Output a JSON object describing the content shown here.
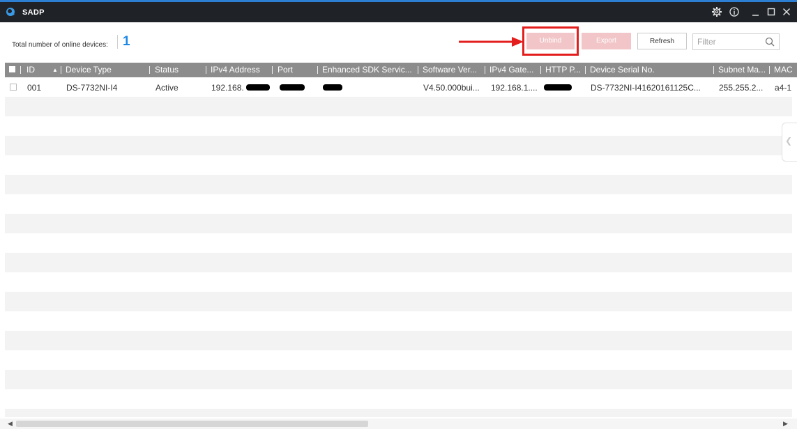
{
  "window": {
    "title": "SADP"
  },
  "toolbar": {
    "total_label": "Total number of online devices:",
    "total_count": "1",
    "unbind_label": "Unbind",
    "export_label": "Export",
    "refresh_label": "Refresh",
    "filter_placeholder": "Filter"
  },
  "colors": {
    "accent": "#1e88e5",
    "titlebar": "#1f2328",
    "header": "#8c8c8c",
    "disabled_button": "#f2c6c8",
    "annotation": "#e41d1d"
  },
  "table": {
    "headers": {
      "id": "ID",
      "device_type": "Device Type",
      "status": "Status",
      "ipv4": "IPv4 Address",
      "port": "Port",
      "sdk": "Enhanced SDK Servic...",
      "software": "Software Ver...",
      "gateway": "IPv4 Gate...",
      "http": "HTTP P...",
      "serial": "Device Serial No.",
      "subnet": "Subnet Ma...",
      "mac": "MAC"
    },
    "rows": [
      {
        "id": "001",
        "device_type": "DS-7732NI-I4",
        "status": "Active",
        "ipv4": "192.168.",
        "software": "V4.50.000bui...",
        "gateway": "192.168.1....",
        "serial": "DS-7732NI-I41620161125C...",
        "subnet": "255.255.2...",
        "mac": "a4-1"
      }
    ]
  },
  "icons": {
    "app": "sadp-logo-icon",
    "settings": "gear-icon",
    "info": "info-icon",
    "minimize": "minimize-icon",
    "maximize": "maximize-icon",
    "close": "close-icon",
    "search": "search-icon",
    "sort": "sort-ascending-icon",
    "collapse": "chevron-left-icon",
    "annotation": "red-arrow-icon"
  }
}
